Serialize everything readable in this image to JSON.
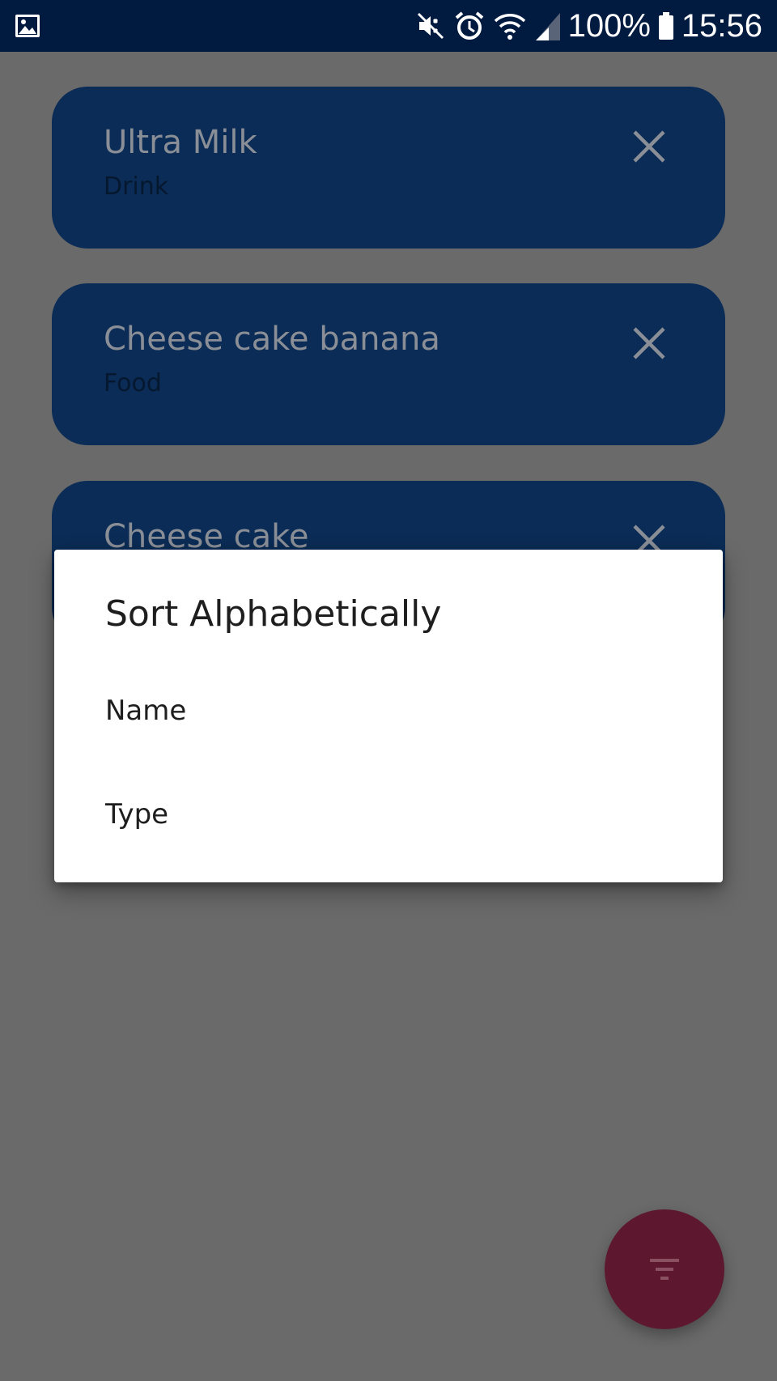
{
  "status_bar": {
    "battery_text": "100%",
    "time": "15:56",
    "icons": [
      "gallery-icon",
      "mute-icon",
      "alarm-icon",
      "wifi-icon",
      "signal-icon",
      "battery-icon"
    ]
  },
  "items": [
    {
      "title": "Ultra Milk",
      "type": "Drink",
      "close_icon": "close-icon"
    },
    {
      "title": "Cheese cake banana",
      "type": "Food",
      "close_icon": "close-icon"
    },
    {
      "title": "Cheese cake",
      "type": "",
      "close_icon": "close-icon"
    }
  ],
  "dialog": {
    "title": "Sort Alphabetically",
    "options": [
      "Name",
      "Type"
    ]
  },
  "fab": {
    "icon": "filter-icon"
  },
  "colors": {
    "status_bar": "#001a40",
    "scrim_background": "#6a6a6a",
    "card": "#0b2c56",
    "fab": "#5d1830",
    "dialog": "#ffffff"
  }
}
